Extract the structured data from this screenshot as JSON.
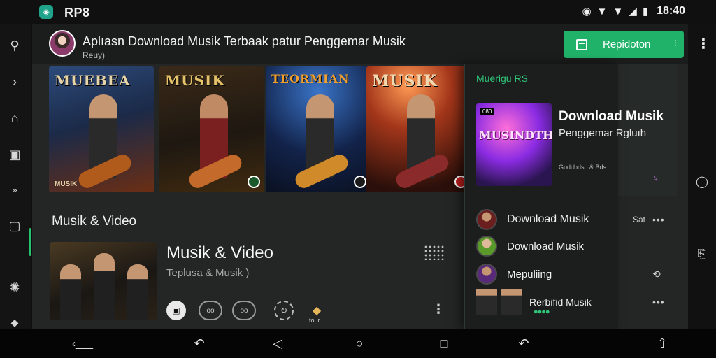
{
  "status_bar": {
    "app_name": "RP8",
    "time": "18:40",
    "battery_icon": "battery-icon",
    "wifi_icon": "wifi-icon",
    "signal_icon": "signal-icon"
  },
  "header": {
    "title": "Aplıasn Download Musik Terbaak patur Penggemar Musik",
    "subtitle": "Reuy)",
    "cta_label": "Repidoton",
    "cta_color": "#21b26a"
  },
  "posters": [
    {
      "title": "MUEBEA",
      "footer": "MUSIK"
    },
    {
      "title": "MUSIK",
      "footer": ""
    },
    {
      "title": "TEORMIAN",
      "footer": ""
    },
    {
      "title": "MUSIK",
      "footer": ""
    }
  ],
  "section": {
    "title": "Musik & Video",
    "card_title": "Musik & Video",
    "card_subtitle": "Teplusa & Musik )",
    "ctrl_a": "oo",
    "ctrl_b": "oo",
    "ctrl_gold": "tour"
  },
  "panel": {
    "heading": "Muerigu RS",
    "feature_title": "Download Musik",
    "feature_subtitle": "Penggemar Rgluıh",
    "feature_thumb_text": "MUSINDTH",
    "feature_thumb_tag": "080",
    "feature_meta": "Goddbdso & Bds",
    "items": [
      {
        "label": "Download Musik",
        "right": "Sat"
      },
      {
        "label": "Download Musik",
        "right": ""
      },
      {
        "label": "Mepuliing",
        "right": ""
      },
      {
        "label": "Rerbifid Musik",
        "right": ""
      }
    ]
  },
  "accent": "#2fc77a"
}
